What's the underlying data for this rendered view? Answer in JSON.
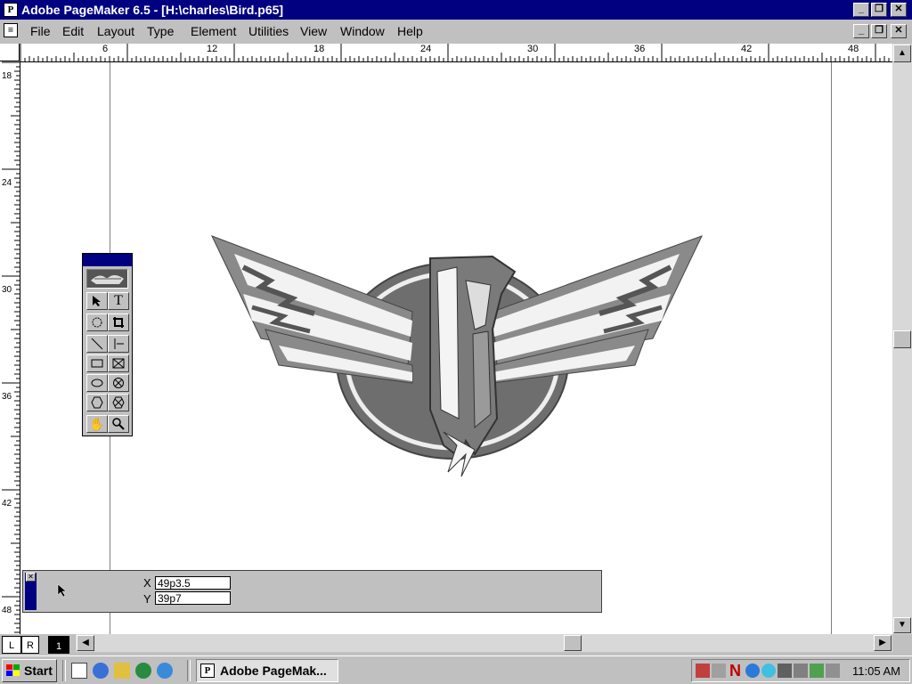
{
  "window": {
    "title": "Adobe PageMaker 6.5 - [H:\\charles\\Bird.p65]",
    "app_icon": "pagemaker-icon",
    "caption_buttons": [
      "minimize",
      "restore",
      "close"
    ]
  },
  "menu": {
    "items": [
      "File",
      "Edit",
      "Layout",
      "Type",
      "Element",
      "Utilities",
      "View",
      "Window",
      "Help"
    ]
  },
  "ruler": {
    "horizontal_labels": [
      "6",
      "12",
      "18",
      "24",
      "30",
      "36",
      "42",
      "48"
    ],
    "vertical_labels": [
      "18",
      "24",
      "30",
      "36",
      "42",
      "48"
    ]
  },
  "toolbox": {
    "tools": [
      "pointer-tool",
      "text-tool",
      "rotate-tool",
      "crop-tool",
      "line-tool",
      "constrained-line-tool",
      "rectangle-tool",
      "rectangle-frame-tool",
      "ellipse-tool",
      "ellipse-frame-tool",
      "polygon-tool",
      "polygon-frame-tool",
      "hand-tool",
      "zoom-tool"
    ]
  },
  "control_palette": {
    "x_label": "X",
    "x_value": "49p3.5",
    "y_label": "Y",
    "y_value": "39p7"
  },
  "page_tabs": {
    "left": "L",
    "right": "R",
    "page": "1"
  },
  "taskbar": {
    "start_label": "Start",
    "task_button_label": "Adobe PageMak...",
    "clock": "11:05 AM",
    "tray_n": "N"
  }
}
